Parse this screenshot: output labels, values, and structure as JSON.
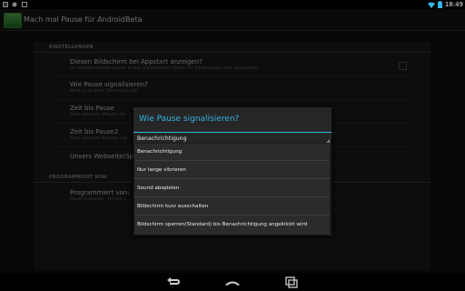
{
  "status_bar": {
    "time": "18:49",
    "left_icons": [
      "picture-icon",
      "android-icon",
      "square-icon"
    ],
    "right_icons": [
      "wifi-icon",
      "battery-icon"
    ]
  },
  "action_bar": {
    "app_title": "Mach mal Pause für AndroidBeta",
    "icon": "app-icon"
  },
  "settings": {
    "section_settings": "EINSTELLUNGEN",
    "items": [
      {
        "title": "Diesen Bildschirm bei Appstart anzeigen?",
        "summary": "Im nächsten Update kannst du das automatische Öffnen der Einstellungen hier deaktivieren"
      },
      {
        "title": "Wie Pause signalisieren?",
        "summary": "What to do when Timer runs out?"
      },
      {
        "title": "Zeit bis Pause",
        "summary": "Nach wievielen Minuten Pa"
      },
      {
        "title": "Zeit bis Pause2",
        "summary": "Nach wievielen Minuten erg"
      },
      {
        "title": "Unsers Webseite(Spi",
        "summary": ""
      }
    ],
    "section_programmed": "PROGRAMMIERT VON:",
    "programmer": {
      "title": "Programmiert von:",
      "summary": "David-LeeKulsch - Hosted a"
    }
  },
  "dialog": {
    "title": "Wie Pause signalisieren?",
    "selected": "Benachrichtigung",
    "options": [
      "Benachrichtigung",
      "Nur lange vibrieren",
      "Sound abspielen",
      "Bildschirm kurz ausschalten",
      "Bildschirm sperren(Standard) bis Benachrichtigung angeklickt wird"
    ]
  },
  "navigation": {
    "buttons": [
      "back-icon",
      "home-icon",
      "recent-apps-icon"
    ]
  },
  "colors": {
    "accent": "#33b5e5",
    "background": "#0f0f0f",
    "dialog": "#262626"
  }
}
